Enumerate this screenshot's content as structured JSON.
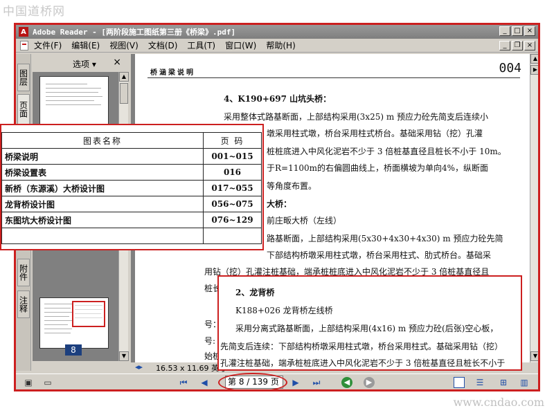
{
  "site": {
    "logo_text": "中国道桥网",
    "url": "www.cndao.com"
  },
  "window": {
    "title": "Adobe Reader - [两阶段施工图纸第三册《桥梁》.pdf]",
    "controls": {
      "minimize": "_",
      "restore": "□",
      "close": "×"
    }
  },
  "menu": {
    "items": [
      "文件(F)",
      "编辑(E)",
      "视图(V)",
      "文档(D)",
      "工具(T)",
      "窗口(W)",
      "帮助(H)"
    ],
    "doc_controls": {
      "minimize": "_",
      "restore": "❐",
      "close": "×"
    }
  },
  "nav_pane": {
    "tabs": [
      "图层",
      "页面",
      "附件",
      "注释"
    ],
    "options_label": "选项 ▾",
    "close_glyph": "×",
    "current_thumb_label": "8"
  },
  "document": {
    "header": "桥涵梁说明",
    "page_number": "004",
    "paragraphs": [
      "4、K190+697 山坑头桥：",
      "采用整体式路基断面，上部结构采用(3x25) m 预应力砼先简支后连续小",
      "墩采用柱式墩，桥台采用柱式桥台。基础采用钻（挖）孔灌",
      "桩桩底进入中风化泥岩不少于 3 倍桩基直径且桩长不小于 10m。",
      "于R=1100m的右偏圆曲线上，桥面横坡为单向4%，纵断面",
      "等角度布置。",
      "大桥：",
      "前庄畈大桥（左线）",
      "路基断面，上部结构采用(5x30+4x30+4x30) m 预应力砼先简",
      "下部结构桥墩采用柱式墩，桥台采用柱式、肋式桥台。基础采",
      "用钻（挖）孔灌注桩基础，端承桩桩底进入中风化泥岩不少于 3 倍桩基直径且",
      "桩长",
      "号：",
      "号:",
      "始桩"
    ],
    "size_label": "16.53 x 11.69 英寸"
  },
  "statusbar": {
    "page_indicator": "第 8 / 139 页",
    "first_glyph": "⏮",
    "prev_glyph": "◀",
    "next_glyph": "▶",
    "last_glyph": "⏭",
    "back_glyph": "◀",
    "forward_glyph": "▶"
  },
  "toc_overlay": {
    "headers": [
      "图表名称",
      "页 码"
    ],
    "rows": [
      {
        "name": "桥梁说明",
        "range": "001~015"
      },
      {
        "name": "桥梁设置表",
        "range": "016"
      },
      {
        "name": "新桥（东源溪）大桥设计图",
        "range": "017~055"
      },
      {
        "name": "龙背桥设计图",
        "range": "056~075"
      },
      {
        "name": "东图坑大桥设计图",
        "range": "076~129"
      },
      {
        "name": "",
        "range": ""
      }
    ]
  },
  "excerpt_overlay": {
    "lines": [
      "2、龙背桥",
      "K188+026 龙背桥左线桥",
      "采用分离式路基断面，上部结构采用(4x16) m 预应力砼(后张)空心板，",
      "先简支后连续：下部结构桥墩采用柱式墩，桥台采用柱式。基础采用钻（挖）",
      "孔灌注桩基础，端承桩桩底进入中风化泥岩不少于 3 倍桩基直径且桩长不小于"
    ]
  }
}
